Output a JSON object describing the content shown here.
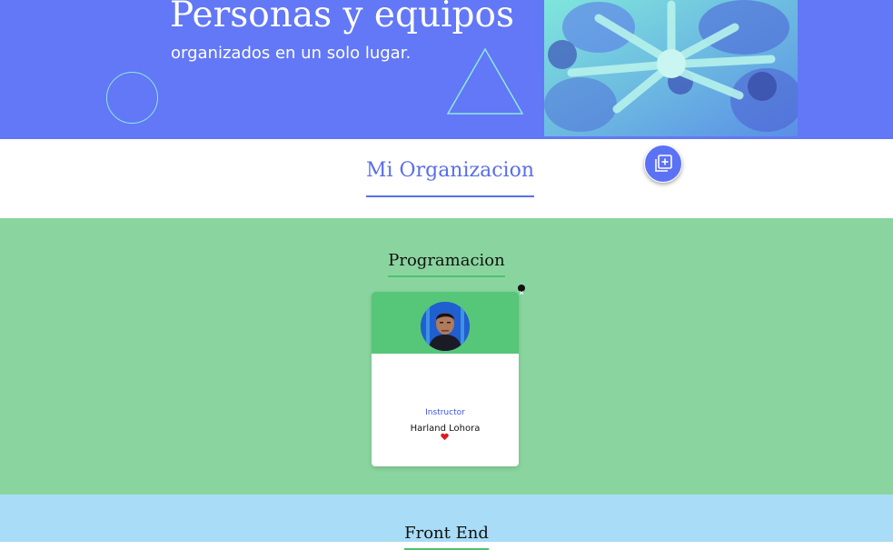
{
  "hero": {
    "title": "Personas y equipos",
    "subtitle": "organizados en un solo lugar."
  },
  "organization": {
    "title": "Mi Organizacion",
    "add_button_icon": "add-copy-icon"
  },
  "teams": [
    {
      "name": "Programacion",
      "background_color": "#8ad59f",
      "accent_color": "#56c678",
      "members": [
        {
          "role": "Instructor",
          "name": "Harland Lohora",
          "favorite": true
        }
      ]
    },
    {
      "name": "Front End",
      "background_color": "#a8dcf7"
    }
  ],
  "colors": {
    "brand": "#6278f6",
    "heart": "#e0181e"
  }
}
